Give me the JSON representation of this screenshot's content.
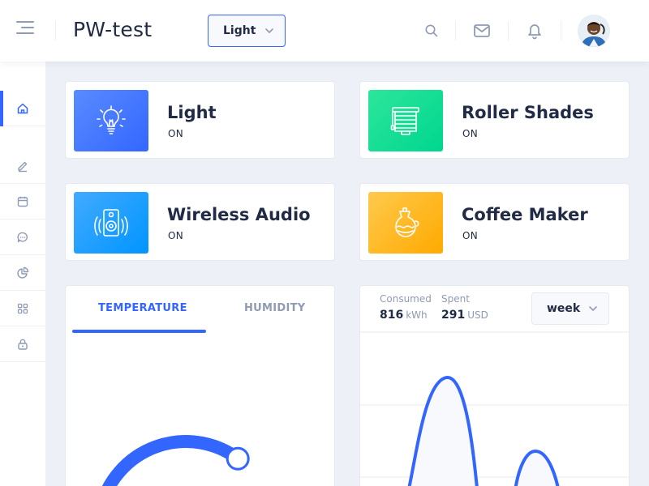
{
  "header": {
    "title": "PW-test",
    "theme_select": {
      "value": "Light"
    },
    "icons": [
      "menu-icon",
      "search-icon",
      "mail-icon",
      "bell-icon"
    ]
  },
  "sidebar": {
    "items": [
      {
        "name": "home",
        "icon": "home-icon",
        "active": true
      },
      {
        "name": "edit",
        "icon": "edit-icon"
      },
      {
        "name": "calendar",
        "icon": "calendar-icon"
      },
      {
        "name": "chat",
        "icon": "chat-icon"
      },
      {
        "name": "chart",
        "icon": "pie-chart-icon"
      },
      {
        "name": "grid",
        "icon": "grid-icon"
      },
      {
        "name": "lock",
        "icon": "lock-icon"
      }
    ]
  },
  "devices": [
    {
      "title": "Light",
      "status": "ON",
      "icon": "lightbulb-icon",
      "color": "#3366ff"
    },
    {
      "title": "Roller Shades",
      "status": "ON",
      "icon": "roller-shades-icon",
      "color": "#00d68f"
    },
    {
      "title": "Wireless Audio",
      "status": "ON",
      "icon": "speaker-icon",
      "color": "#0095ff"
    },
    {
      "title": "Coffee Maker",
      "status": "ON",
      "icon": "coffee-maker-icon",
      "color": "#ffaa00"
    }
  ],
  "temperature_card": {
    "tabs": [
      {
        "label": "TEMPERATURE",
        "active": true
      },
      {
        "label": "HUMIDITY",
        "active": false
      }
    ],
    "dial_value_pct": 0.38
  },
  "electricity_card": {
    "consumed": {
      "label": "Consumed",
      "value": "816",
      "unit": "kWh"
    },
    "spent": {
      "label": "Spent",
      "value": "291",
      "unit": "USD"
    },
    "period": "week"
  },
  "colors": {
    "primary": "#3366ff",
    "text": "#222b45",
    "hint": "#8f9bb3",
    "background": "#edf1f7"
  }
}
